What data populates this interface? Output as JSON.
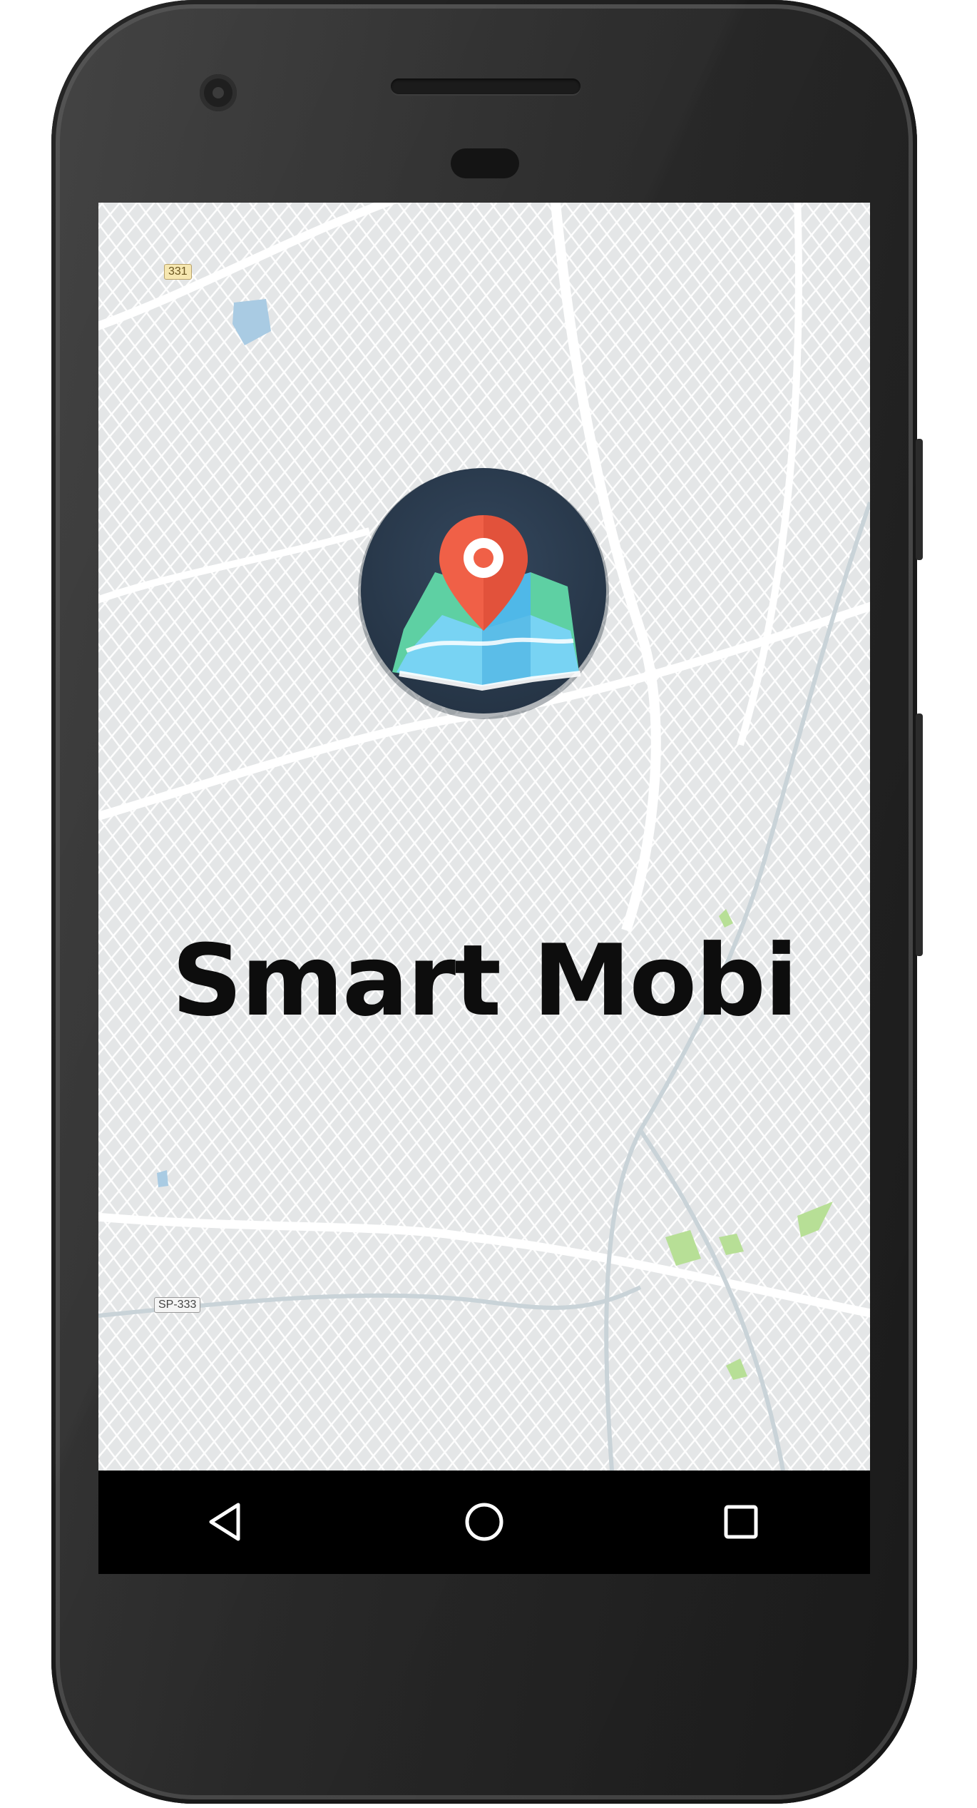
{
  "app": {
    "title": "Smart Mobi"
  },
  "map": {
    "road_labels": {
      "shield_1": "331",
      "shield_2": "SP-333"
    },
    "colors": {
      "land": "#e4e6e7",
      "road": "#ffffff",
      "water": "#a9cbe3",
      "park": "#b7df96",
      "rail": "#c9d3d8"
    }
  },
  "logo": {
    "icon": "map-pin-icon",
    "colors": {
      "circle": "#2b3a4c",
      "pin": "#f06047",
      "map_green": "#5ed0a3",
      "map_blue": "#6dc6f0"
    }
  },
  "nav_bar": {
    "back_icon": "back-triangle-icon",
    "home_icon": "home-circle-icon",
    "recents_icon": "recents-square-icon"
  }
}
